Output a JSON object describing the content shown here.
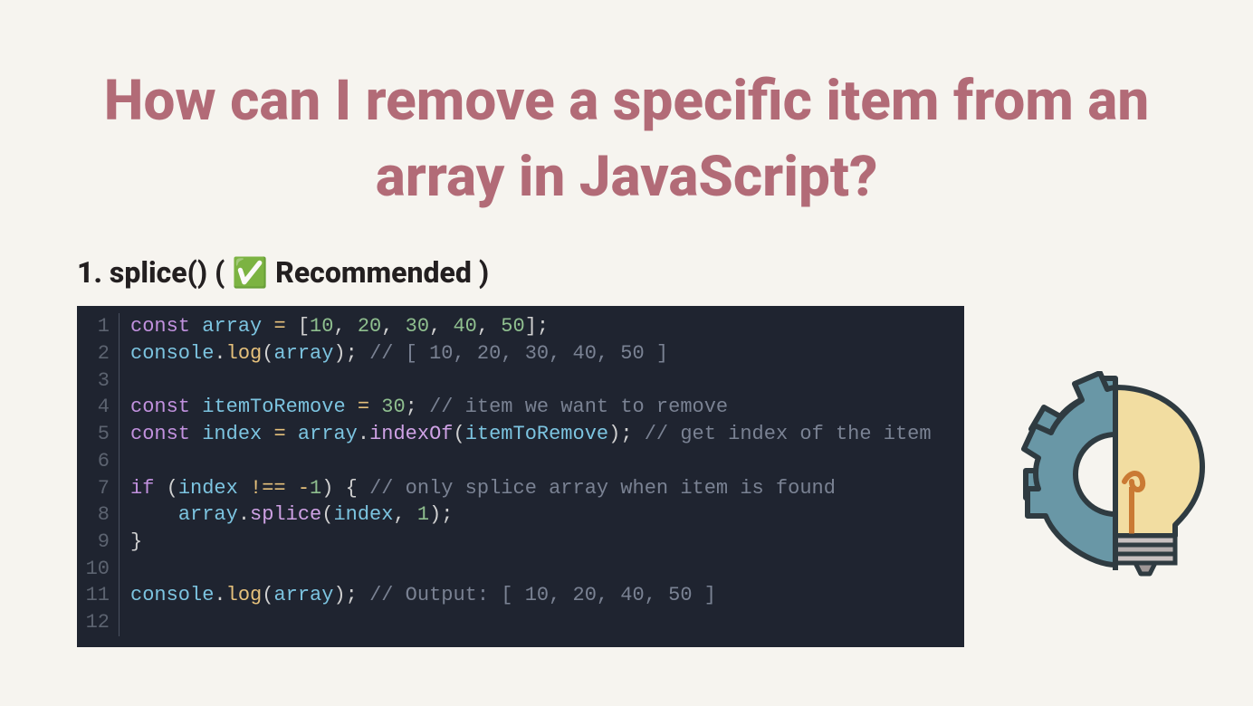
{
  "title": "How can I remove a specific item from an array in JavaScript?",
  "sectionHeading": "1. splice() ( ✅ Recommended )",
  "code": {
    "lines": [
      {
        "n": "1",
        "tokens": [
          [
            "kw",
            "const"
          ],
          [
            "punc",
            " "
          ],
          [
            "var",
            "array"
          ],
          [
            "punc",
            " "
          ],
          [
            "op",
            "="
          ],
          [
            "punc",
            " ["
          ],
          [
            "num",
            "10"
          ],
          [
            "punc",
            ", "
          ],
          [
            "num",
            "20"
          ],
          [
            "punc",
            ", "
          ],
          [
            "num",
            "30"
          ],
          [
            "punc",
            ", "
          ],
          [
            "num",
            "40"
          ],
          [
            "punc",
            ", "
          ],
          [
            "num",
            "50"
          ],
          [
            "punc",
            "];"
          ]
        ]
      },
      {
        "n": "2",
        "tokens": [
          [
            "var",
            "console"
          ],
          [
            "punc",
            "."
          ],
          [
            "prop",
            "log"
          ],
          [
            "punc",
            "("
          ],
          [
            "var",
            "array"
          ],
          [
            "punc",
            "); "
          ],
          [
            "cmt",
            "// [ 10, 20, 30, 40, 50 ]"
          ]
        ]
      },
      {
        "n": "3",
        "tokens": []
      },
      {
        "n": "4",
        "tokens": [
          [
            "kw",
            "const"
          ],
          [
            "punc",
            " "
          ],
          [
            "var",
            "itemToRemove"
          ],
          [
            "punc",
            " "
          ],
          [
            "op",
            "="
          ],
          [
            "punc",
            " "
          ],
          [
            "num",
            "30"
          ],
          [
            "punc",
            "; "
          ],
          [
            "cmt",
            "// item we want to remove"
          ]
        ]
      },
      {
        "n": "5",
        "tokens": [
          [
            "kw",
            "const"
          ],
          [
            "punc",
            " "
          ],
          [
            "var",
            "index"
          ],
          [
            "punc",
            " "
          ],
          [
            "op",
            "="
          ],
          [
            "punc",
            " "
          ],
          [
            "var",
            "array"
          ],
          [
            "punc",
            "."
          ],
          [
            "fn",
            "indexOf"
          ],
          [
            "punc",
            "("
          ],
          [
            "var",
            "itemToRemove"
          ],
          [
            "punc",
            "); "
          ],
          [
            "cmt",
            "// get index of the item"
          ]
        ]
      },
      {
        "n": "6",
        "tokens": []
      },
      {
        "n": "7",
        "tokens": [
          [
            "kw",
            "if"
          ],
          [
            "punc",
            " ("
          ],
          [
            "var",
            "index"
          ],
          [
            "punc",
            " "
          ],
          [
            "op",
            "!=="
          ],
          [
            "punc",
            " "
          ],
          [
            "op",
            "-"
          ],
          [
            "num",
            "1"
          ],
          [
            "punc",
            ") { "
          ],
          [
            "cmt",
            "// only splice array when item is found"
          ]
        ]
      },
      {
        "n": "8",
        "tokens": [
          [
            "punc",
            "    "
          ],
          [
            "var",
            "array"
          ],
          [
            "punc",
            "."
          ],
          [
            "fn",
            "splice"
          ],
          [
            "punc",
            "("
          ],
          [
            "var",
            "index"
          ],
          [
            "punc",
            ", "
          ],
          [
            "num",
            "1"
          ],
          [
            "punc",
            ");"
          ]
        ]
      },
      {
        "n": "9",
        "tokens": [
          [
            "punc",
            "}"
          ]
        ]
      },
      {
        "n": "10",
        "tokens": []
      },
      {
        "n": "11",
        "tokens": [
          [
            "var",
            "console"
          ],
          [
            "punc",
            "."
          ],
          [
            "prop",
            "log"
          ],
          [
            "punc",
            "("
          ],
          [
            "var",
            "array"
          ],
          [
            "punc",
            "); "
          ],
          [
            "cmt",
            "// Output: [ 10, 20, 40, 50 ]"
          ]
        ]
      },
      {
        "n": "12",
        "tokens": []
      }
    ]
  }
}
